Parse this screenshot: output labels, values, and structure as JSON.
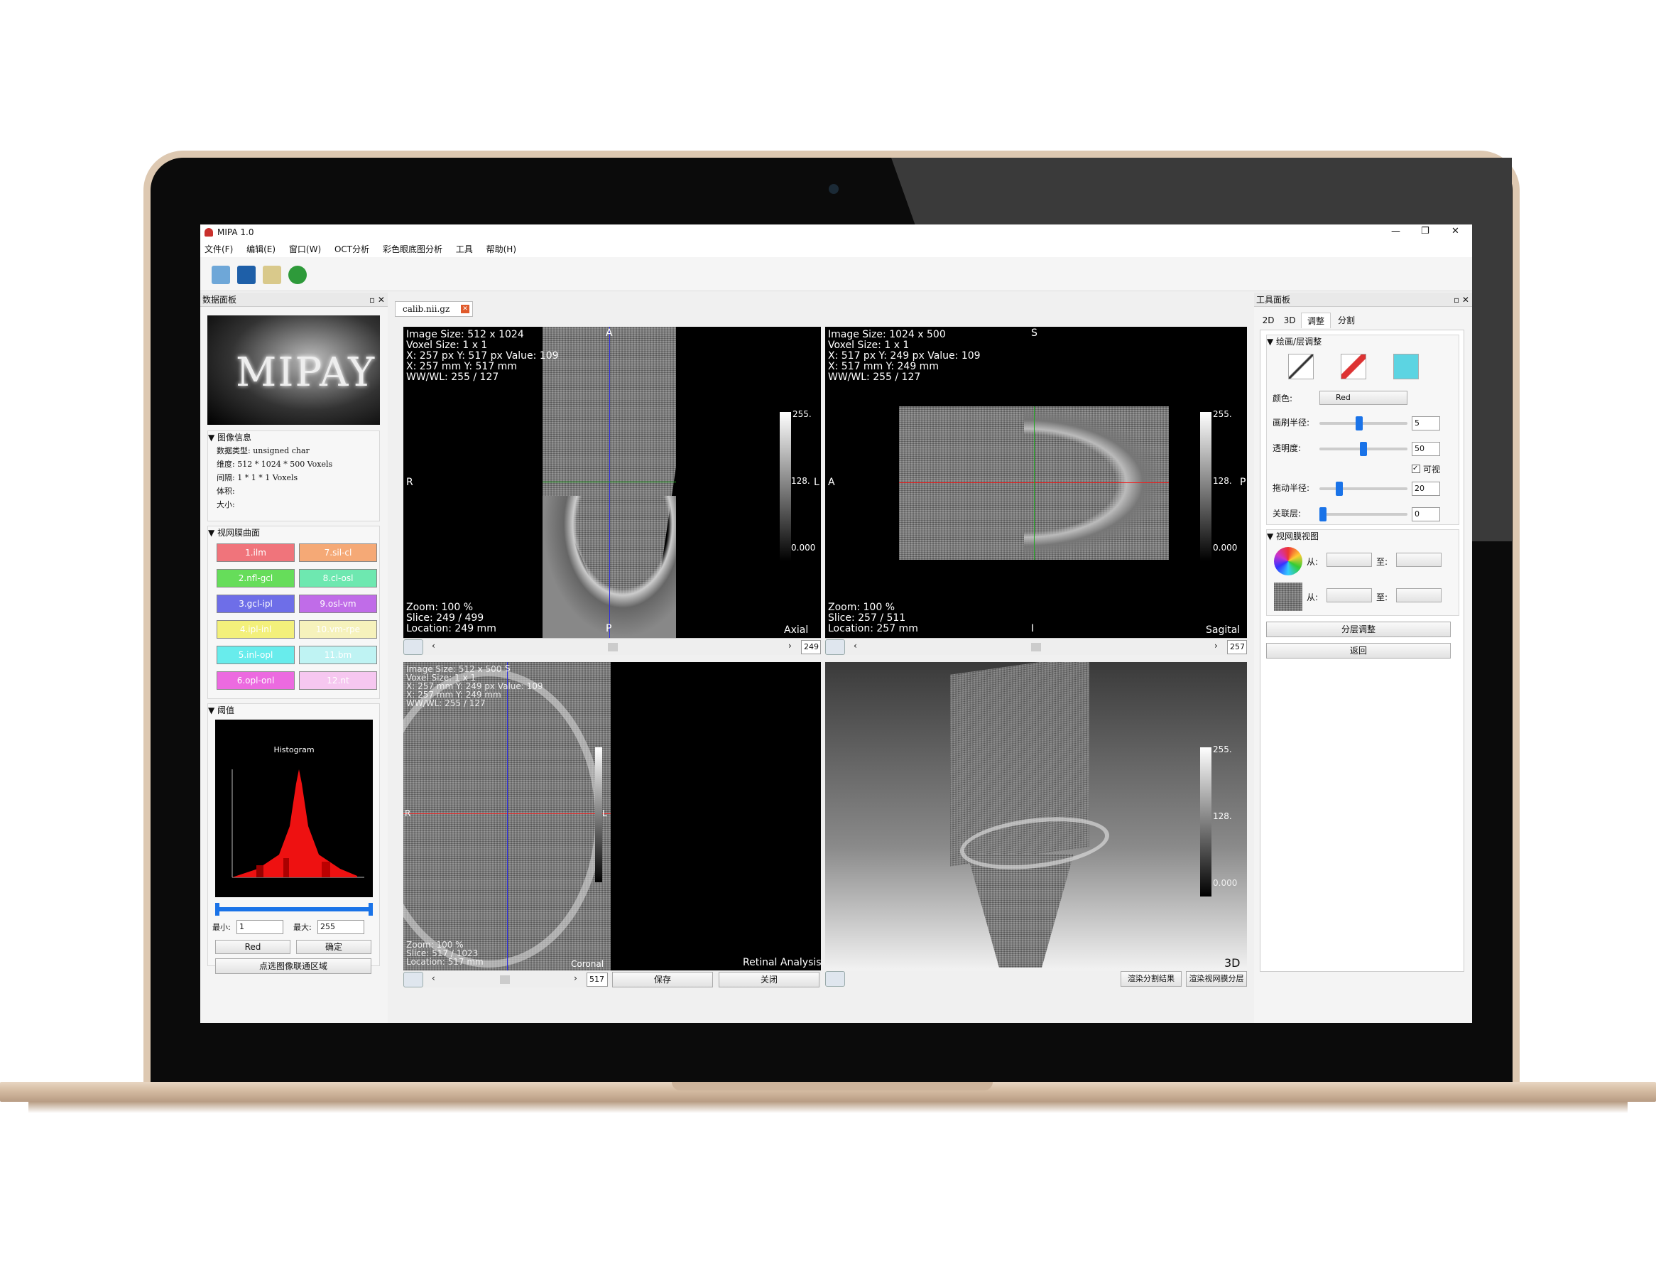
{
  "app": {
    "title": "MIPA 1.0",
    "controls": {
      "minimize": "—",
      "restore": "❐",
      "close": "✕"
    }
  },
  "menu": [
    "文件(F)",
    "编辑(E)",
    "窗口(W)",
    "OCT分析",
    "彩色眼底图分析",
    "工具",
    "帮助(H)"
  ],
  "data_panel": {
    "title": "数据面板",
    "logo": "MIPAY",
    "image_info": {
      "header": "图像信息",
      "rows": [
        {
          "label": "数据类型:",
          "value": "unsigned char"
        },
        {
          "label": "维度:",
          "value": "512  *  1024  *  500  Voxels"
        },
        {
          "label": "间隔:",
          "value": "1    *  1     *  1    Voxels"
        },
        {
          "label": "体积:",
          "value": ""
        },
        {
          "label": "大小:",
          "value": ""
        }
      ]
    },
    "surfaces": {
      "header": "视网膜曲面",
      "items": [
        {
          "label": "1.ilm",
          "color": "#f0747b"
        },
        {
          "label": "7.sil-cl",
          "color": "#f5a976"
        },
        {
          "label": "2.nfl-gcl",
          "color": "#66dd5a"
        },
        {
          "label": "8.cl-osl",
          "color": "#6ee8b0"
        },
        {
          "label": "3.gcl-ipl",
          "color": "#6e6ee8"
        },
        {
          "label": "9.osl-vm",
          "color": "#c06ce8"
        },
        {
          "label": "4.ipl-inl",
          "color": "#f3f07b"
        },
        {
          "label": "10.vm-rpe",
          "color": "#f6f2bc"
        },
        {
          "label": "5.inl-opl",
          "color": "#68ecec"
        },
        {
          "label": "11.bm",
          "color": "#bff3f3"
        },
        {
          "label": "6.opl-onl",
          "color": "#ec6ae0"
        },
        {
          "label": "12.nt",
          "color": "#f6c7f0"
        }
      ]
    },
    "threshold": {
      "header": "阈值",
      "histogram_title": "Histogram",
      "min_label": "最小:",
      "min_value": "1",
      "max_label": "最大:",
      "max_value": "255",
      "color": "Red",
      "confirm": "确定",
      "select_region": "点选图像联通区域"
    }
  },
  "doc_tab": "calib.nii.gz",
  "views": {
    "axial": {
      "overlay": "Image Size: 512 x 1024\nVoxel Size: 1 x 1\nX: 257 px Y: 517 px Value: 109\nX: 257 mm Y: 517 mm\nWW/WL: 255 / 127",
      "bottom": "Zoom: 100 %\nSlice: 249 / 499\nLocation: 249 mm",
      "name": "Axial",
      "top": "A",
      "bot": "P",
      "left": "R",
      "right": "L",
      "scale": [
        "255.",
        "128.",
        "0.000"
      ],
      "slice": "249"
    },
    "sagittal": {
      "overlay": "Image Size: 1024 x 500\nVoxel Size: 1 x 1\nX: 517 px Y: 249 px Value: 109\nX: 517 mm Y: 249 mm\nWW/WL: 255 / 127",
      "bottom": "Zoom: 100 %\nSlice: 257 / 511\nLocation: 257 mm",
      "name": "Sagital",
      "top": "S",
      "bot": "I",
      "left": "A",
      "right": "P",
      "scale": [
        "255.",
        "128.",
        "0.000"
      ],
      "slice": "257"
    },
    "coronal": {
      "overlay": "Image Size: 512 x 500\nVoxel Size: 1 x 1\nX: 257 mm Y: 249 px Value: 109\nX: 257 mm Y: 249 mm\nWW/WL: 255 / 127",
      "bottom": "Zoom: 100 %\nSlice: 517 / 1023\nLocation: 517 mm",
      "name": "Coronal",
      "top": "S",
      "left": "R",
      "right": "L",
      "slice": "517"
    },
    "retinal": {
      "name": "Retinal Analysis",
      "save": "保存",
      "close": "关闭"
    },
    "three_d": {
      "name": "3D",
      "scale": [
        "255.",
        "128.",
        "0.000"
      ],
      "render_seg": "渲染分割结果",
      "render_layers": "渲染视网膜分层"
    }
  },
  "tool_panel": {
    "title": "工具面板",
    "tabs": [
      "2D",
      "3D",
      "调整",
      "分割"
    ],
    "active_tab": "调整",
    "draw": {
      "header": "绘画/层调整",
      "color_label": "颜色:",
      "color_value": "Red",
      "brush_label": "画刷半径:",
      "brush_value": "5",
      "brush_frac": 0.45,
      "opacity_label": "透明度:",
      "opacity_value": "50",
      "opacity_frac": 0.5,
      "visible_label": "可视",
      "drag_label": "拖动半径:",
      "drag_value": "20",
      "drag_frac": 0.2,
      "layer_label": "关联层:",
      "layer_value": "0",
      "layer_frac": 0.0
    },
    "retina_view": {
      "header": "视网膜视图",
      "from": "从:",
      "to": "至:"
    },
    "layer_adjust": "分层调整",
    "back": "返回"
  }
}
